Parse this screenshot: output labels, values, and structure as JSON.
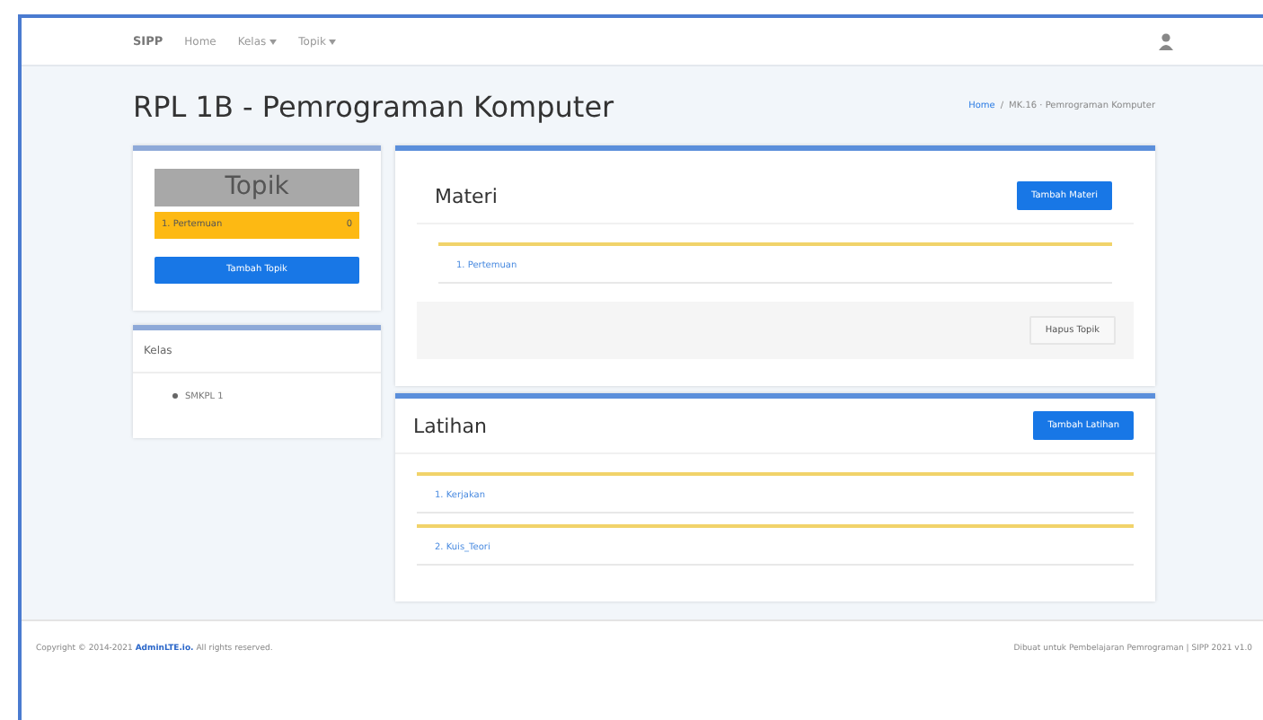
{
  "navbar": {
    "logo": "SIPP",
    "items": [
      {
        "label": "Home",
        "dropdown": false
      },
      {
        "label": "Kelas",
        "dropdown": true
      },
      {
        "label": "Topik",
        "dropdown": true
      }
    ]
  },
  "page": {
    "title": "RPL 1B - Pemrograman Komputer",
    "breadcrumb_separator": "/",
    "breadcrumb": [
      {
        "label": "Home",
        "link": true
      },
      {
        "label": "MK.16 · Pemrograman Komputer",
        "link": false
      }
    ]
  },
  "topik_card": {
    "header": "Topik",
    "items": [
      {
        "label": "1. Pertemuan",
        "count": "0",
        "selected": true
      }
    ],
    "button": "Tambah Topik"
  },
  "kelas_card": {
    "header": "Kelas",
    "items": [
      "SMKPL 1"
    ]
  },
  "materi": {
    "title": "Materi",
    "button": "Tambah Materi",
    "items": [
      "1. Pertemuan"
    ],
    "footer_button": "Hapus Topik"
  },
  "latihan": {
    "title": "Latihan",
    "button": "Tambah Latihan",
    "items": [
      "1. Kerjakan",
      "2. Kuis_Teori"
    ]
  },
  "footer": {
    "copyright": "Copyright © 2014-2021",
    "brand": "AdminLTE.io.",
    "rights": "All rights reserved.",
    "right": "Dibuat untuk Pembelajaran Pemrograman | SIPP 2021 v1.0"
  }
}
